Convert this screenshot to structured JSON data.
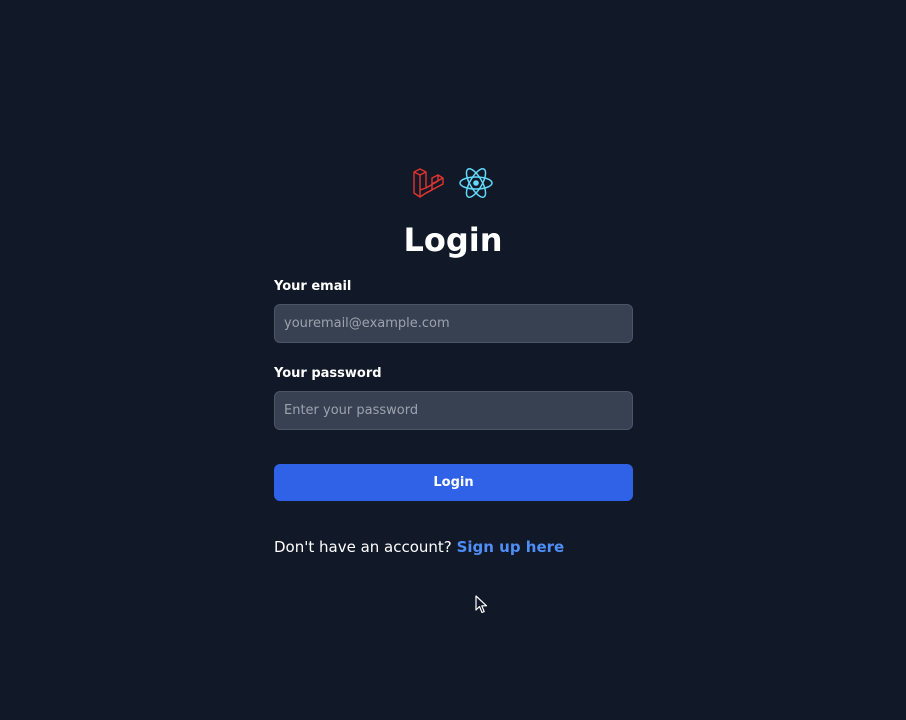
{
  "logos": {
    "laravel": "laravel-logo",
    "react": "react-logo",
    "laravel_color": "#e3342f",
    "react_color": "#61dafb"
  },
  "page": {
    "title": "Login"
  },
  "form": {
    "email_label": "Your email",
    "email_placeholder": "youremail@example.com",
    "email_value": "",
    "password_label": "Your password",
    "password_placeholder": "Enter your password",
    "password_value": "",
    "submit_label": "Login"
  },
  "signup": {
    "prompt": "Don't have an account?",
    "link_label": "Sign up here"
  },
  "colors": {
    "background": "#111827",
    "input_bg": "#374151",
    "button": "#2f62e6",
    "link": "#4f8ef7"
  }
}
